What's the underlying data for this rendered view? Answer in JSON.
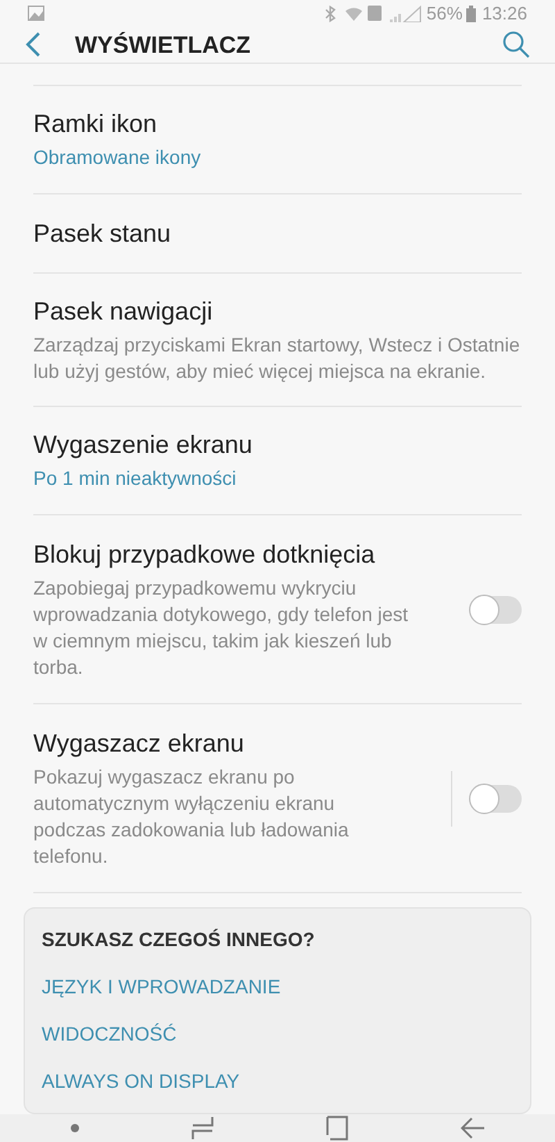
{
  "status_bar": {
    "battery": "56%",
    "time": "13:26"
  },
  "header": {
    "title": "WYŚWIETLACZ"
  },
  "items": [
    {
      "kind": "value",
      "title": "Ramki ikon",
      "value": "Obramowane ikony"
    },
    {
      "kind": "plain",
      "title": "Pasek stanu"
    },
    {
      "kind": "description",
      "title": "Pasek nawigacji",
      "description": "Zarządzaj przyciskami Ekran startowy, Wstecz i Ostatnie lub użyj gestów, aby mieć więcej miejsca na ekranie."
    },
    {
      "kind": "value",
      "title": "Wygaszenie ekranu",
      "value": "Po 1 min nieaktywności"
    },
    {
      "kind": "toggle",
      "title": "Blokuj przypadkowe dotknięcia",
      "description": "Zapobiegaj przypadkowemu wykryciu wprowadzania dotykowego, gdy telefon jest w ciemnym miejscu, takim jak kieszeń lub torba.",
      "on": false,
      "split": false
    },
    {
      "kind": "toggle",
      "title": "Wygaszacz ekranu",
      "description": "Pokazuj wygaszacz ekranu po automatycznym wyłączeniu ekranu podczas zadokowania lub ładowania telefonu.",
      "on": false,
      "split": true
    }
  ],
  "suggestions": {
    "heading": "SZUKASZ CZEGOŚ INNEGO?",
    "links": [
      "JĘZYK I WPROWADZANIE",
      "WIDOCZNOŚĆ",
      "ALWAYS ON DISPLAY"
    ]
  }
}
